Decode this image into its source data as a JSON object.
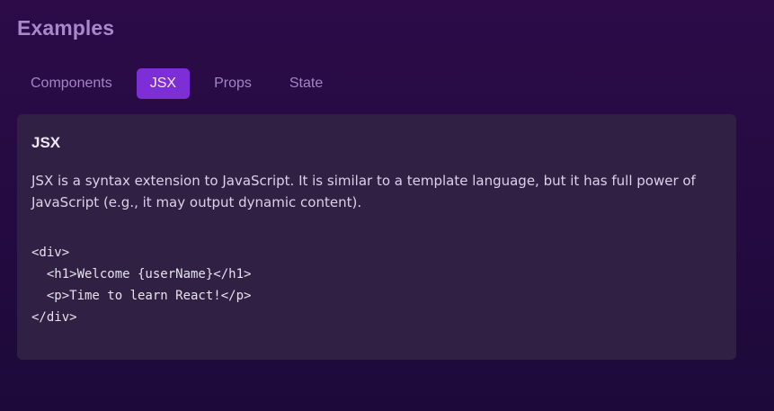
{
  "section": {
    "title": "Examples"
  },
  "tabs": [
    {
      "label": "Components",
      "active": false
    },
    {
      "label": "JSX",
      "active": true
    },
    {
      "label": "Props",
      "active": false
    },
    {
      "label": "State",
      "active": false
    }
  ],
  "panel": {
    "heading": "JSX",
    "description": "JSX is a syntax extension to JavaScript. It is similar to a template language, but it has full power of JavaScript (e.g., it may output dynamic content).",
    "code_lines": [
      "<div>",
      "  <h1>Welcome {userName}</h1>",
      "  <p>Time to learn React!</p>",
      "</div>"
    ]
  },
  "colors": {
    "background": "#2c0b48",
    "accent": "#7e2ed6",
    "panel": "#302043",
    "title": "#a988c9"
  }
}
